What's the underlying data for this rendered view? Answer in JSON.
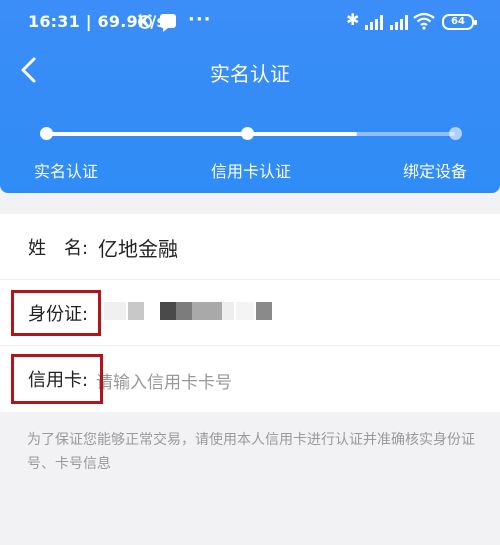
{
  "status_bar": {
    "time": "16:31",
    "net_speed": "69.9K/s",
    "battery": "64",
    "icons": [
      "alarm-icon",
      "message-icon",
      "more-icon",
      "bluetooth-icon",
      "hd-signal-icon",
      "wifi-icon",
      "battery-icon"
    ]
  },
  "header": {
    "title": "实名认证",
    "back_icon": "chevron-left-icon",
    "accent_color": "#3c8df7"
  },
  "steps": {
    "items": [
      {
        "label": "实名认证",
        "state": "done"
      },
      {
        "label": "信用卡认证",
        "state": "current"
      },
      {
        "label": "绑定设备",
        "state": "pending"
      }
    ],
    "progress": 0.76
  },
  "form": {
    "name_label": "姓　名:",
    "name_value": "亿地金融",
    "id_label": "身份证:",
    "card_label": "信用卡:",
    "card_placeholder": "请输入信用卡卡号"
  },
  "tip": "为了保证您能够正常交易，请使用本人信用卡进行认证并准确核实身份证号、卡号信息",
  "highlight_color": "#b3141a"
}
